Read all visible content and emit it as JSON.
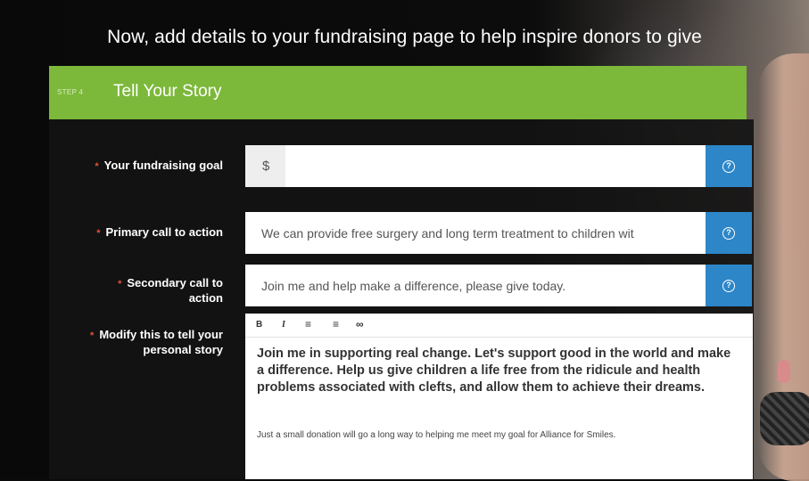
{
  "header": {
    "heading": "Now, add details to your fundraising page to help inspire donors to give"
  },
  "step": {
    "number": "STEP 4",
    "title": "Tell Your Story"
  },
  "form": {
    "required_mark": "*",
    "goal": {
      "label": "Your fundraising goal",
      "currency": "$",
      "value": ""
    },
    "primary_cta": {
      "label": "Primary call to action",
      "value": "We can provide free surgery and long term treatment to children wit"
    },
    "secondary_cta": {
      "label_line1": "Secondary call to",
      "label_line2": "action",
      "value": "Join me and help make a difference, please give today."
    },
    "story": {
      "label_line1": "Modify this to tell your",
      "label_line2": "personal story",
      "toolbar": {
        "bold": "B",
        "italic": "I",
        "bullets": "≡",
        "numbered": "≡",
        "link": "∞"
      },
      "heading": "Join me in supporting real change. Let's support good in the world and make a difference. Help us give children a life free from the ridicule and health problems associated with clefts, and allow them to achieve their dreams.",
      "body": "Just a small donation will go a long way to helping me meet my goal for Alliance for Smiles."
    },
    "help_icon": "question-mark-icon",
    "help_symbol": "?"
  },
  "colors": {
    "step_green": "#7cb83a",
    "help_blue": "#2d86c8",
    "required_red": "#e0533a"
  }
}
